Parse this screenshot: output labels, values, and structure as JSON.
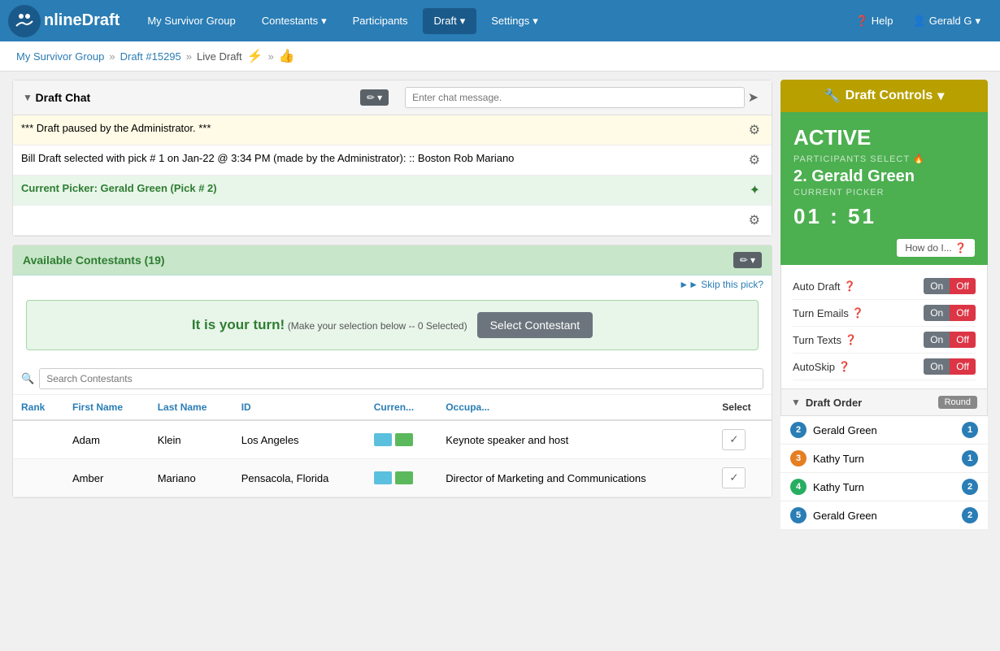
{
  "app": {
    "logo_text": "nlineDraft",
    "title": "Survivor Group"
  },
  "nav": {
    "my_survivor_group": "My Survivor Group",
    "contestants": "Contestants",
    "participants": "Participants",
    "draft": "Draft",
    "settings": "Settings",
    "help": "Help",
    "user": "Gerald G"
  },
  "breadcrumb": {
    "group": "My Survivor Group",
    "draft": "Draft #15295",
    "current": "Live Draft"
  },
  "draft_chat": {
    "title": "Draft Chat",
    "input_placeholder": "Enter chat message.",
    "messages": [
      {
        "text": "*** Draft paused by the Administrator. ***",
        "type": "warning"
      },
      {
        "text": "Bill Draft selected with pick # 1 on Jan-22 @ 3:34 PM (made by the Administrator):\n:: Boston Rob Mariano",
        "type": "info"
      },
      {
        "text": "Current Picker: Gerald Green (Pick # 2)",
        "type": "current"
      }
    ]
  },
  "contestants": {
    "section_title": "Available Contestants (19)",
    "skip_text": "►► Skip this pick?",
    "your_turn": "It is your turn!",
    "your_turn_sub": "(Make your selection below -- 0 Selected)",
    "select_btn": "Select Contestant",
    "search_placeholder": "Search Contestants",
    "columns": [
      "Rank",
      "First Name",
      "Last Name",
      "ID",
      "Curren...",
      "Occupa...",
      "Select"
    ],
    "rows": [
      {
        "rank": "",
        "first": "Adam",
        "last": "Klein",
        "id": "Los Angeles",
        "current": "",
        "occupation": "Keynote speaker and host",
        "select": "✓"
      },
      {
        "rank": "",
        "first": "Amber",
        "last": "Mariano",
        "id": "Pensacola, Florida",
        "current": "",
        "occupation": "Director of Marketing and Communications",
        "select": "✓"
      }
    ]
  },
  "draft_controls": {
    "title": "Draft Controls",
    "status": "ACTIVE",
    "participants_label": "PARTICIPANTS SELECT",
    "current_picker": "2. Gerald Green",
    "current_picker_label": "CURRENT PICKER",
    "timer": "01 : 51",
    "how_do_btn": "How do I...",
    "settings": [
      {
        "label": "Auto Draft",
        "on": "On",
        "off": "Off"
      },
      {
        "label": "Turn Emails",
        "on": "On",
        "off": "Off"
      },
      {
        "label": "Turn Texts",
        "on": "On",
        "off": "Off"
      },
      {
        "label": "AutoSkip",
        "on": "On",
        "off": "Off"
      }
    ],
    "draft_order_title": "Draft Order",
    "round_label": "Round",
    "order_items": [
      {
        "num": "2",
        "name": "Gerald Green",
        "round": "1",
        "color": "blue"
      },
      {
        "num": "3",
        "name": "Kathy Turn",
        "round": "1",
        "color": "orange"
      },
      {
        "num": "4",
        "name": "Kathy Turn",
        "round": "2",
        "color": "green"
      },
      {
        "num": "5",
        "name": "Gerald Green",
        "round": "2",
        "color": "blue"
      }
    ]
  }
}
